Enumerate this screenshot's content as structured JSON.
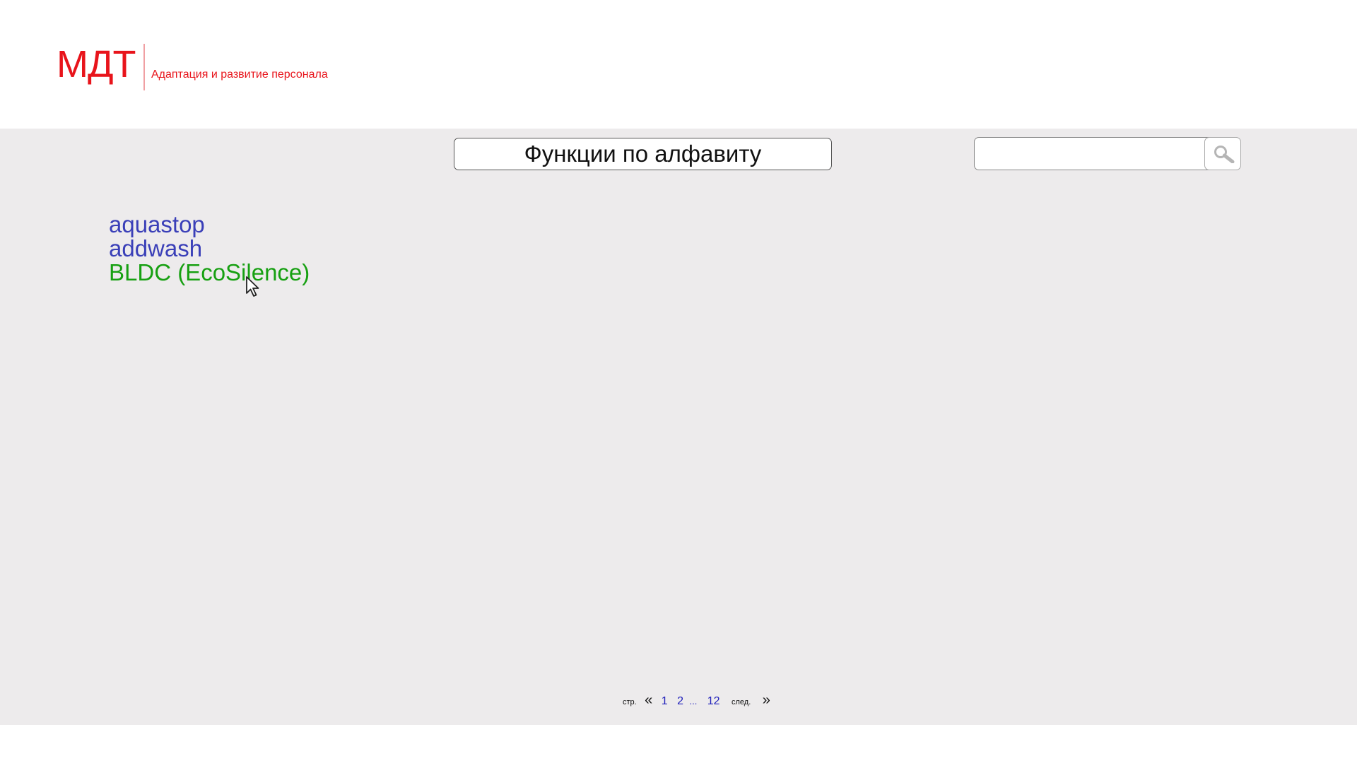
{
  "header": {
    "logo": "МДТ",
    "tagline": "Адаптация и развитие персонала",
    "brand_color": "#e8141b"
  },
  "main": {
    "title": "Функции по алфавиту",
    "search": {
      "value": "",
      "placeholder": "",
      "button_icon": "search-icon"
    },
    "functions": [
      {
        "label": "aquastop",
        "state": "link",
        "color": "#3a3fb8"
      },
      {
        "label": "addwash",
        "state": "link",
        "color": "#3a3fb8"
      },
      {
        "label": "BLDC (EcoSilence)",
        "state": "hovered",
        "color": "#17a012"
      }
    ]
  },
  "pagination": {
    "page_label": "стр.",
    "prev_symbol": "«",
    "pages": [
      "1",
      "2",
      "...",
      "12"
    ],
    "next_label": "след.",
    "next_symbol": "»",
    "link_color": "#2222bb"
  }
}
